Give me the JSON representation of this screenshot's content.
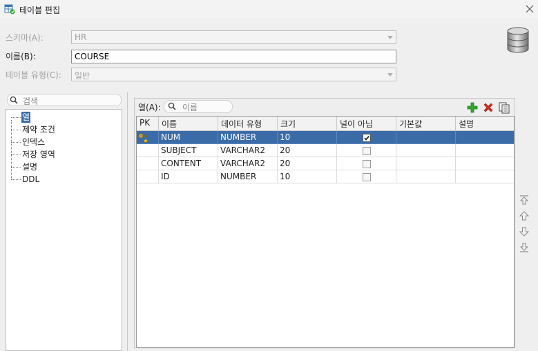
{
  "window": {
    "title": "테이블 편집"
  },
  "form": {
    "schema_label": "스키마(A):",
    "schema_value": "HR",
    "name_label": "이름(B):",
    "name_value": "COURSE",
    "type_label": "테이블 유형(C):",
    "type_value": "일반"
  },
  "nav": {
    "search_placeholder": "검색",
    "items": [
      {
        "label": "열",
        "selected": true
      },
      {
        "label": "제약 조건"
      },
      {
        "label": "인덱스"
      },
      {
        "label": "저장 영역"
      },
      {
        "label": "설명"
      },
      {
        "label": "DDL"
      }
    ]
  },
  "columns_panel": {
    "label": "열(A):",
    "search_placeholder": "이름",
    "headers": [
      "PK",
      "이름",
      "데이터 유형",
      "크기",
      "널이 아님",
      "기본값",
      "설명"
    ],
    "rows": [
      {
        "pk": true,
        "name": "NUM",
        "type": "NUMBER",
        "size": "10",
        "not_null": true,
        "default": "",
        "comment": ""
      },
      {
        "pk": false,
        "name": "SUBJECT",
        "type": "VARCHAR2",
        "size": "20",
        "not_null": false,
        "default": "",
        "comment": ""
      },
      {
        "pk": false,
        "name": "CONTENT",
        "type": "VARCHAR2",
        "size": "20",
        "not_null": false,
        "default": "",
        "comment": ""
      },
      {
        "pk": false,
        "name": "ID",
        "type": "NUMBER",
        "size": "10",
        "not_null": false,
        "default": "",
        "comment": ""
      }
    ]
  },
  "icons": {
    "add": "plus-icon",
    "delete": "x-icon",
    "copy": "copy-icon",
    "database": "database-icon"
  },
  "colors": {
    "selection": "#3b6ca8",
    "add_green": "#2fa82f",
    "delete_red": "#d42a1e"
  }
}
